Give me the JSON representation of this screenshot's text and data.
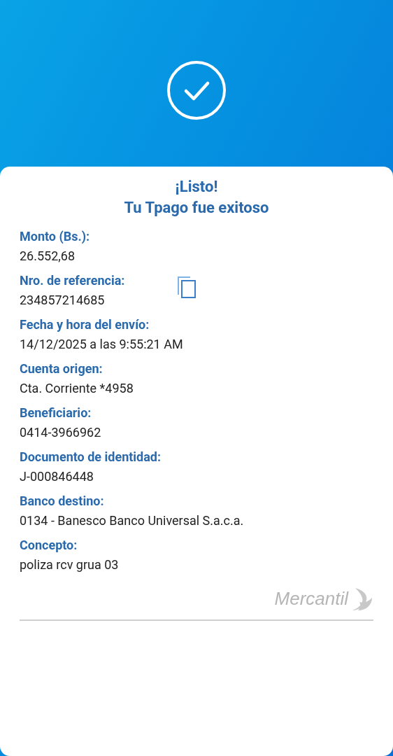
{
  "title": "¡Listo!",
  "subtitle": "Tu Tpago fue exitoso",
  "fields": [
    {
      "label": "Monto (Bs.):",
      "value": "26.552,68",
      "copyable": false
    },
    {
      "label": "Nro. de referencia:",
      "value": "234857214685",
      "copyable": true
    },
    {
      "label": "Fecha y hora del envío:",
      "value": "14/12/2025 a las 9:55:21 AM",
      "copyable": false
    },
    {
      "label": "Cuenta origen:",
      "value": "Cta. Corriente *4958",
      "copyable": false
    },
    {
      "label": "Beneficiario:",
      "value": "0414-3966962",
      "copyable": false
    },
    {
      "label": "Documento de identidad:",
      "value": "J-000846448",
      "copyable": false
    },
    {
      "label": "Banco destino:",
      "value": "0134 - Banesco Banco Universal S.a.c.a.",
      "copyable": false
    },
    {
      "label": "Concepto:",
      "value": "poliza rcv grua 03",
      "copyable": false
    }
  ],
  "brand": "Mercantil"
}
